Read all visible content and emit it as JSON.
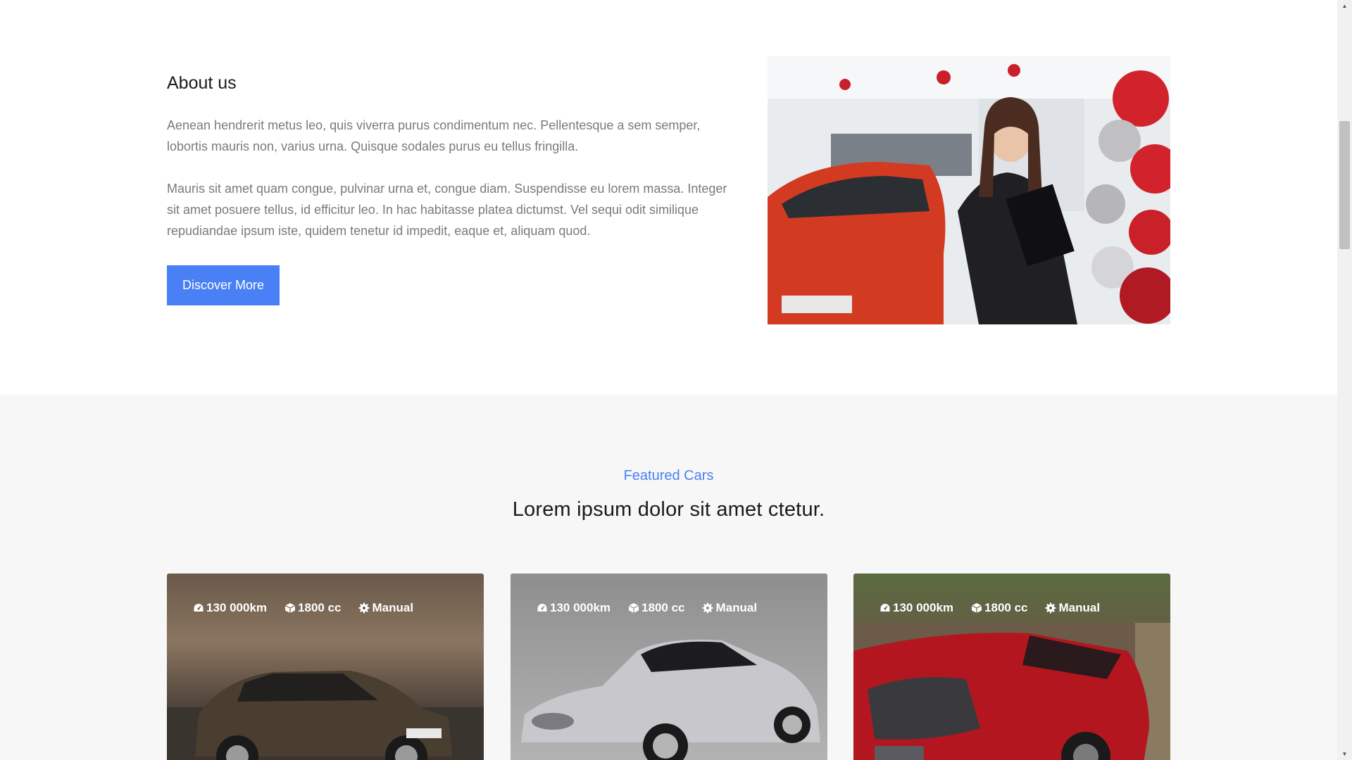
{
  "about": {
    "title": "About us",
    "paragraph1": "Aenean hendrerit metus leo, quis viverra purus condimentum nec. Pellentesque a sem semper, lobortis mauris non, varius urna. Quisque sodales purus eu tellus fringilla.",
    "paragraph2": "Mauris sit amet quam congue, pulvinar urna et, congue diam. Suspendisse eu lorem massa. Integer sit amet posuere tellus, id efficitur leo. In hac habitasse platea dictumst. Vel sequi odit similique repudiandae ipsum iste, quidem tenetur id impedit, eaque et, aliquam quod.",
    "button_label": "Discover More",
    "image_name": "saleswoman-in-car-showroom-photo"
  },
  "featured": {
    "eyebrow": "Featured Cars",
    "heading": "Lorem ipsum dolor sit amet ctetur.",
    "accent_color": "#4a80f5",
    "cars": [
      {
        "mileage": "130 000km",
        "engine": "1800 cc",
        "transmission": "Manual",
        "image_name": "brown-hatchback-photo"
      },
      {
        "mileage": "130 000km",
        "engine": "1800 cc",
        "transmission": "Manual",
        "image_name": "silver-roadster-photo"
      },
      {
        "mileage": "130 000km",
        "engine": "1800 cc",
        "transmission": "Manual",
        "image_name": "red-suv-photo"
      }
    ]
  },
  "icons": {
    "mileage": "speedometer-icon",
    "engine": "engine-cube-icon",
    "transmission": "gear-icon"
  }
}
